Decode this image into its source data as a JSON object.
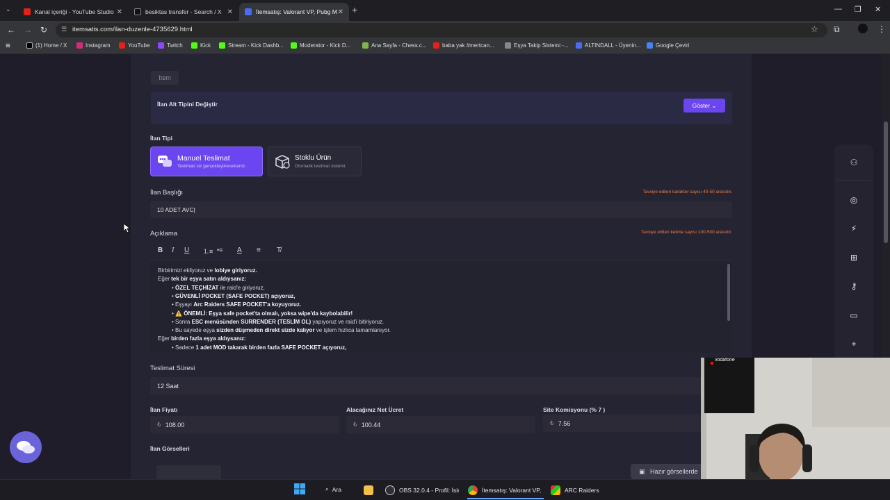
{
  "browser": {
    "tabs": [
      {
        "label": "Kanal içeriği - YouTube Studio",
        "active": false
      },
      {
        "label": "besiktas transfer - Search / X",
        "active": false
      },
      {
        "label": "İtemsatış: Valorant VP, Pubg M",
        "active": true
      }
    ],
    "url": "itemsatis.com/ilan-duzenle-4735629.html",
    "bookmarks": [
      "(1) Home / X",
      "Instagram",
      "YouTube",
      "Twitch",
      "Kick",
      "Stream - Kick Dashb...",
      "Moderator - Kick D...",
      "Ana Sayfa - Chess.c...",
      "baba yak #mertcan...",
      "Eşya Takip Sistemi -...",
      "ALTINDALL - Üyenin...",
      "Google Çeviri"
    ]
  },
  "form": {
    "item_pill": "Item",
    "subtype_label": "İlan Alt Tipini Değiştir",
    "show_button": "Göster",
    "type_label": "İlan Tipi",
    "type_cards": [
      {
        "title": "Manuel Teslimat",
        "subtitle": "Teslimatı siz gerçekleştireceksiniz."
      },
      {
        "title": "Stoklu Ürün",
        "subtitle": "Otomatik teslimat sistemi."
      }
    ],
    "title_label": "İlan Başlığı",
    "title_hint": "Tavsiye edilen karakter sayısı 40-50 arasıdır.",
    "title_value": "10 ADET AVC|",
    "description_label": "Açıklama",
    "description_hint": "Tavsiye edilen kelime sayısı 100-500 arasıdır.",
    "delivery_label": "Teslimat Süresi",
    "delivery_value": "12 Saat",
    "price_label": "İlan Fiyatı",
    "price_value": "108.00",
    "net_label": "Alacağınız Net Ücret",
    "net_value": "100.44",
    "commission_label": "Site Komisyonu (% 7 )",
    "commission_value": "7.56",
    "currency_symbol": "₺",
    "images_label": "İlan Görselleri",
    "ready_images_button": "Hazır görsellerde"
  },
  "description_lines": [
    {
      "indent": false,
      "parts": [
        [
          "Birbirimizi ekliyoruz ve ",
          false
        ],
        [
          "lobiye giriyoruz.",
          true
        ]
      ]
    },
    {
      "indent": false,
      "parts": [
        [
          "Eğer ",
          false
        ],
        [
          "tek bir eşya satın aldıysanız:",
          true
        ]
      ]
    },
    {
      "indent": true,
      "parts": [
        [
          "• ",
          false
        ],
        [
          "ÖZEL TEÇHİZAT",
          true
        ],
        [
          " ile raid'e giriyoruz,",
          false
        ]
      ]
    },
    {
      "indent": true,
      "parts": [
        [
          "• ",
          false
        ],
        [
          "GÜVENLİ POCKET (SAFE POCKET) açıyoruz,",
          true
        ]
      ]
    },
    {
      "indent": true,
      "parts": [
        [
          "• Eşyayı ",
          false
        ],
        [
          "Arc Raiders SAFE POCKET'a koyuyoruz.",
          true
        ]
      ]
    },
    {
      "indent": true,
      "parts": [
        [
          "• ⚠️ ",
          false
        ],
        [
          "ÖNEMLİ: Eşya safe pocket'ta olmalı, yoksa wipe'da kaybolabilir!",
          true
        ]
      ]
    },
    {
      "indent": true,
      "parts": [
        [
          "• Sonra ",
          false
        ],
        [
          "ESC menüsünden SURRENDER (TESLİM OL)",
          true
        ],
        [
          " yapıyoruz ve raid'i bitiriyoruz.",
          false
        ]
      ]
    },
    {
      "indent": true,
      "parts": [
        [
          "• Bu sayede eşya ",
          false
        ],
        [
          "sizden düşmeden direkt sizde kalıyor",
          true
        ],
        [
          " ve işlem hızlıca tamamlanıyor.",
          false
        ]
      ]
    },
    {
      "indent": false,
      "parts": [
        [
          "Eğer ",
          false
        ],
        [
          "birden fazla eşya aldıysanız:",
          true
        ]
      ]
    },
    {
      "indent": true,
      "parts": [
        [
          "• Sadece ",
          false
        ],
        [
          "1 adet MOD takarak birden fazla SAFE POCKET açıyoruz,",
          true
        ]
      ]
    }
  ],
  "taskbar": {
    "search": "Ara",
    "items": [
      "OBS 32.0.4 - Profil: İsims",
      "İtemsatış: Valorant VP, F",
      "ARC Raiders"
    ]
  },
  "webcam": {
    "logo_text": "vodafone"
  },
  "colors": {
    "accent": "#6b46f0",
    "hint": "#f07b3f",
    "bg": "#1e1d29"
  }
}
